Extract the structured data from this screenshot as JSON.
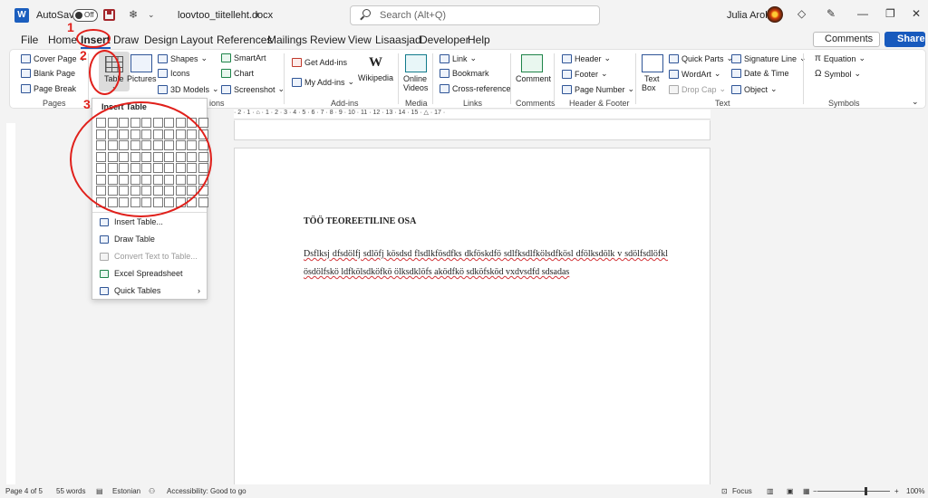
{
  "titlebar": {
    "autosave_label": "AutoSave",
    "autosave_state": "Off",
    "document_name": "loovtoo_tiitelleht.docx",
    "search_placeholder": "Search (Alt+Q)",
    "user_name": "Julia Arold"
  },
  "menu": {
    "items": [
      "File",
      "Home",
      "Insert",
      "Draw",
      "Design",
      "Layout",
      "References",
      "Mailings",
      "Review",
      "View",
      "Lisaasjad",
      "Developer",
      "Help"
    ],
    "active": "Insert",
    "comments_label": "Comments",
    "share_label": "Share"
  },
  "ribbon": {
    "pages": {
      "items": [
        "Cover Page",
        "Blank Page",
        "Page Break"
      ],
      "label": "Pages"
    },
    "table_label": "Table",
    "illustrations": {
      "pictures": "Pictures",
      "shapes": "Shapes",
      "icons": "Icons",
      "models": "3D Models",
      "smartart": "SmartArt",
      "chart": "Chart",
      "screenshot": "Screenshot",
      "label_partial": "ions"
    },
    "addins": {
      "get": "Get Add-ins",
      "my": "My Add-ins",
      "wikipedia": "Wikipedia",
      "label": "Add-ins"
    },
    "media": {
      "online_videos_1": "Online",
      "online_videos_2": "Videos",
      "label": "Media"
    },
    "links": {
      "link": "Link",
      "bookmark": "Bookmark",
      "crossref": "Cross-reference",
      "label": "Links"
    },
    "comments": {
      "comment": "Comment",
      "label": "Comments"
    },
    "header_footer": {
      "header": "Header",
      "footer": "Footer",
      "page_number": "Page Number",
      "label": "Header & Footer"
    },
    "text": {
      "textbox_1": "Text",
      "textbox_2": "Box",
      "quick_parts": "Quick Parts",
      "wordart": "WordArt",
      "drop_cap": "Drop Cap",
      "signature": "Signature Line",
      "datetime": "Date & Time",
      "object": "Object",
      "label": "Text"
    },
    "symbols": {
      "equation": "Equation",
      "symbol": "Symbol",
      "label": "Symbols"
    }
  },
  "ruler": {
    "labels": "· 2 · 1 · ⌂ · 1 · 2 · 3 · 4 · 5 · 6 · 7 · 8 · 9 · 10 · 11 · 12 · 13 · 14 · 15 · △ · 17 ·"
  },
  "dropdown": {
    "title": "Insert Table",
    "grid_cols": 10,
    "grid_rows": 8,
    "items": [
      {
        "label": "Insert Table...",
        "disabled": false
      },
      {
        "label": "Draw Table",
        "disabled": false
      },
      {
        "label": "Convert Text to Table...",
        "disabled": true
      },
      {
        "label": "Excel Spreadsheet",
        "disabled": false
      },
      {
        "label": "Quick Tables",
        "disabled": false
      }
    ]
  },
  "annotations": [
    "1",
    "2",
    "3"
  ],
  "document": {
    "heading": "TÖÖ TEOREETILINE OSA",
    "body": "Dsflksj dfsdölfj sdlöfj kösdsd flsdlkfösdfks dkföskdfö sdlfksdlfkölsdfkösl dfölksdölk v sdölfsdlöfkl ösdölfskö ldfkölsdköfkö ölksdklöfs aködfkö sdköfsköd vxdvsdfd sdsadas"
  },
  "statusbar": {
    "page": "Page 4 of 5",
    "words": "55 words",
    "language": "Estonian",
    "accessibility": "Accessibility: Good to go",
    "focus": "Focus",
    "zoom": "100%"
  },
  "colors": {
    "accent": "#185abd",
    "annotation": "#e0201b"
  }
}
